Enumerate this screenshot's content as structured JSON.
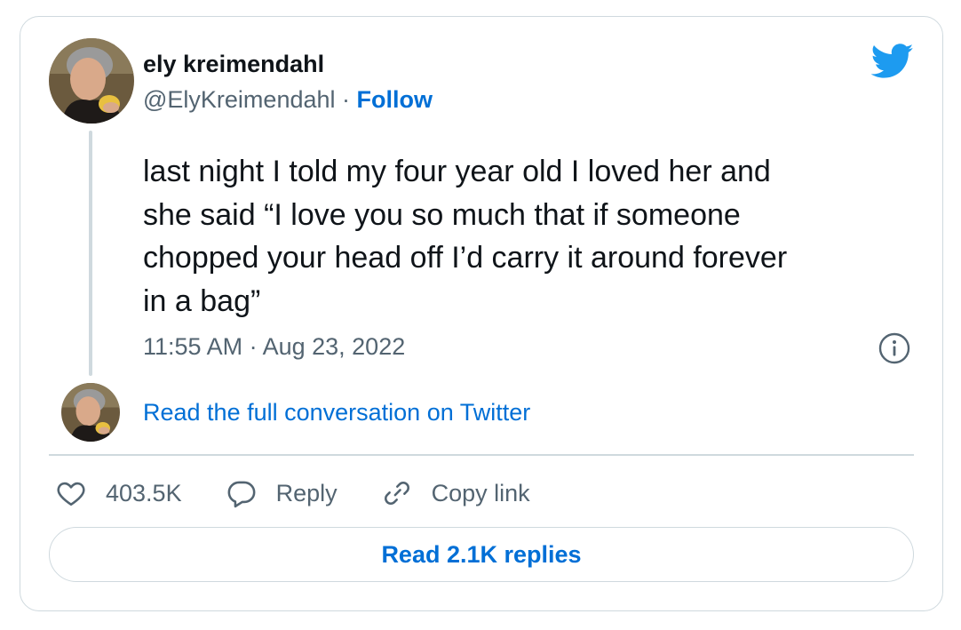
{
  "author": {
    "name": "ely kreimendahl",
    "handle": "@ElyKreimendahl",
    "separator": " · ",
    "follow_label": "Follow"
  },
  "tweet": {
    "text": "last night I told my four year old I loved her and\nshe said “I love you so much that if someone\nchopped your head off I’d carry it around forever\nin a bag”",
    "timestamp": "11:55 AM · Aug 23, 2022"
  },
  "conversation_link": "Read the full conversation on Twitter",
  "actions": {
    "likes": "403.5K",
    "reply_label": "Reply",
    "copy_link_label": "Copy link"
  },
  "replies_button": "Read 2.1K replies",
  "icons": {
    "brand": "twitter-bird-icon",
    "info": "info-icon",
    "like": "heart-icon",
    "reply": "reply-bubble-icon",
    "copy": "link-icon"
  },
  "colors": {
    "link": "#006fd6",
    "twitter_blue": "#1d9bf0",
    "secondary_text": "#536471",
    "border": "#cfd9de"
  }
}
